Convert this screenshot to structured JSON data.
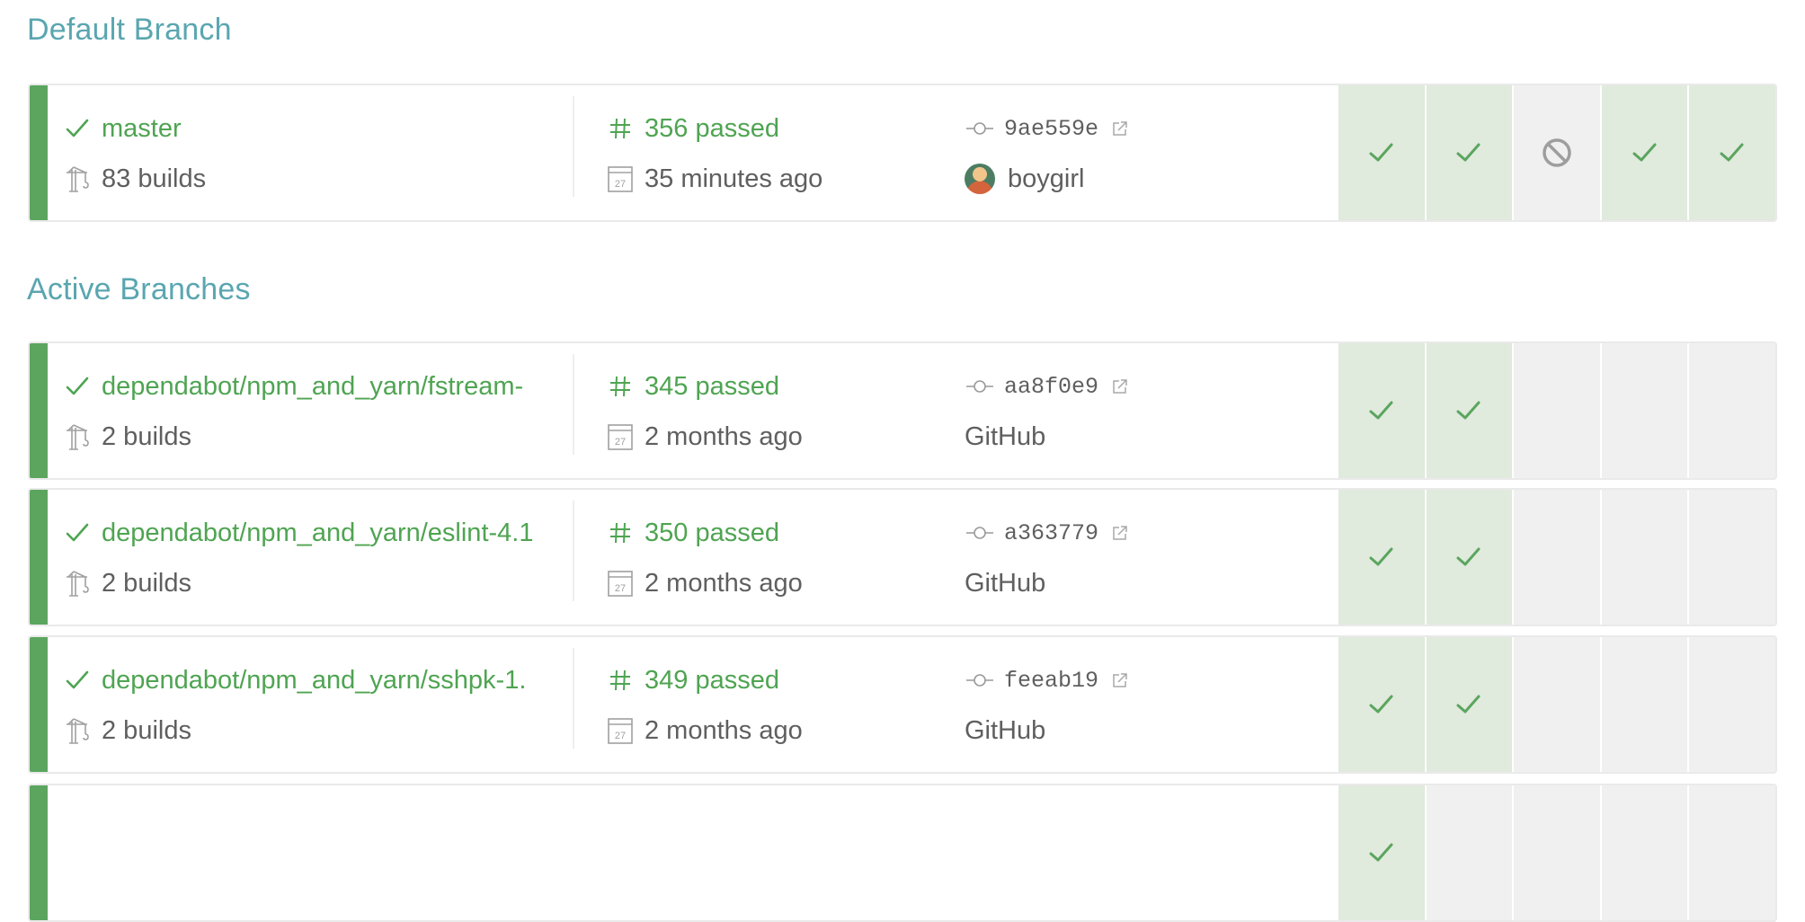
{
  "sections": {
    "default_title": "Default Branch",
    "active_title": "Active Branches"
  },
  "colors": {
    "accent_teal": "#5aa6b0",
    "passed_green": "#4fa452",
    "status_bar_green": "#5ba55e",
    "passed_cell_bg": "#e0eadd",
    "empty_cell_bg": "#f0f0f0",
    "canceled_icon_gray": "#9e9e9e"
  },
  "default_branch": {
    "status": "passed",
    "name": "master",
    "builds": "83 builds",
    "build_number": "356 passed",
    "time": "35 minutes ago",
    "commit": "9ae559e",
    "author": "boygirl",
    "has_avatar": true,
    "history": [
      "passed",
      "passed",
      "canceled",
      "passed",
      "passed"
    ]
  },
  "active_branches": [
    {
      "status": "passed",
      "name": "dependabot/npm_and_yarn/fstream-",
      "builds": "2 builds",
      "build_number": "345 passed",
      "time": "2 months ago",
      "commit": "aa8f0e9",
      "author": "GitHub",
      "has_avatar": false,
      "history": [
        "passed",
        "passed",
        "empty",
        "empty",
        "empty"
      ]
    },
    {
      "status": "passed",
      "name": "dependabot/npm_and_yarn/eslint-4.1",
      "builds": "2 builds",
      "build_number": "350 passed",
      "time": "2 months ago",
      "commit": "a363779",
      "author": "GitHub",
      "has_avatar": false,
      "history": [
        "passed",
        "passed",
        "empty",
        "empty",
        "empty"
      ]
    },
    {
      "status": "passed",
      "name": "dependabot/npm_and_yarn/sshpk-1.",
      "builds": "2 builds",
      "build_number": "349 passed",
      "time": "2 months ago",
      "commit": "feeab19",
      "author": "GitHub",
      "has_avatar": false,
      "history": [
        "passed",
        "passed",
        "empty",
        "empty",
        "empty"
      ]
    },
    {
      "status": "passed",
      "name": "",
      "builds": "",
      "build_number": "",
      "time": "",
      "commit": "",
      "author": "",
      "has_avatar": false,
      "history": [
        "passed",
        "empty",
        "empty",
        "empty",
        "empty"
      ]
    }
  ],
  "icons": {
    "status": "check-icon",
    "builds": "crane-icon",
    "build_number": "hash-icon",
    "time": "calendar-icon",
    "commit": "commit-icon",
    "external": "external-link-icon",
    "history_passed": "check-icon",
    "history_canceled": "canceled-icon"
  },
  "calendar_day": "27"
}
